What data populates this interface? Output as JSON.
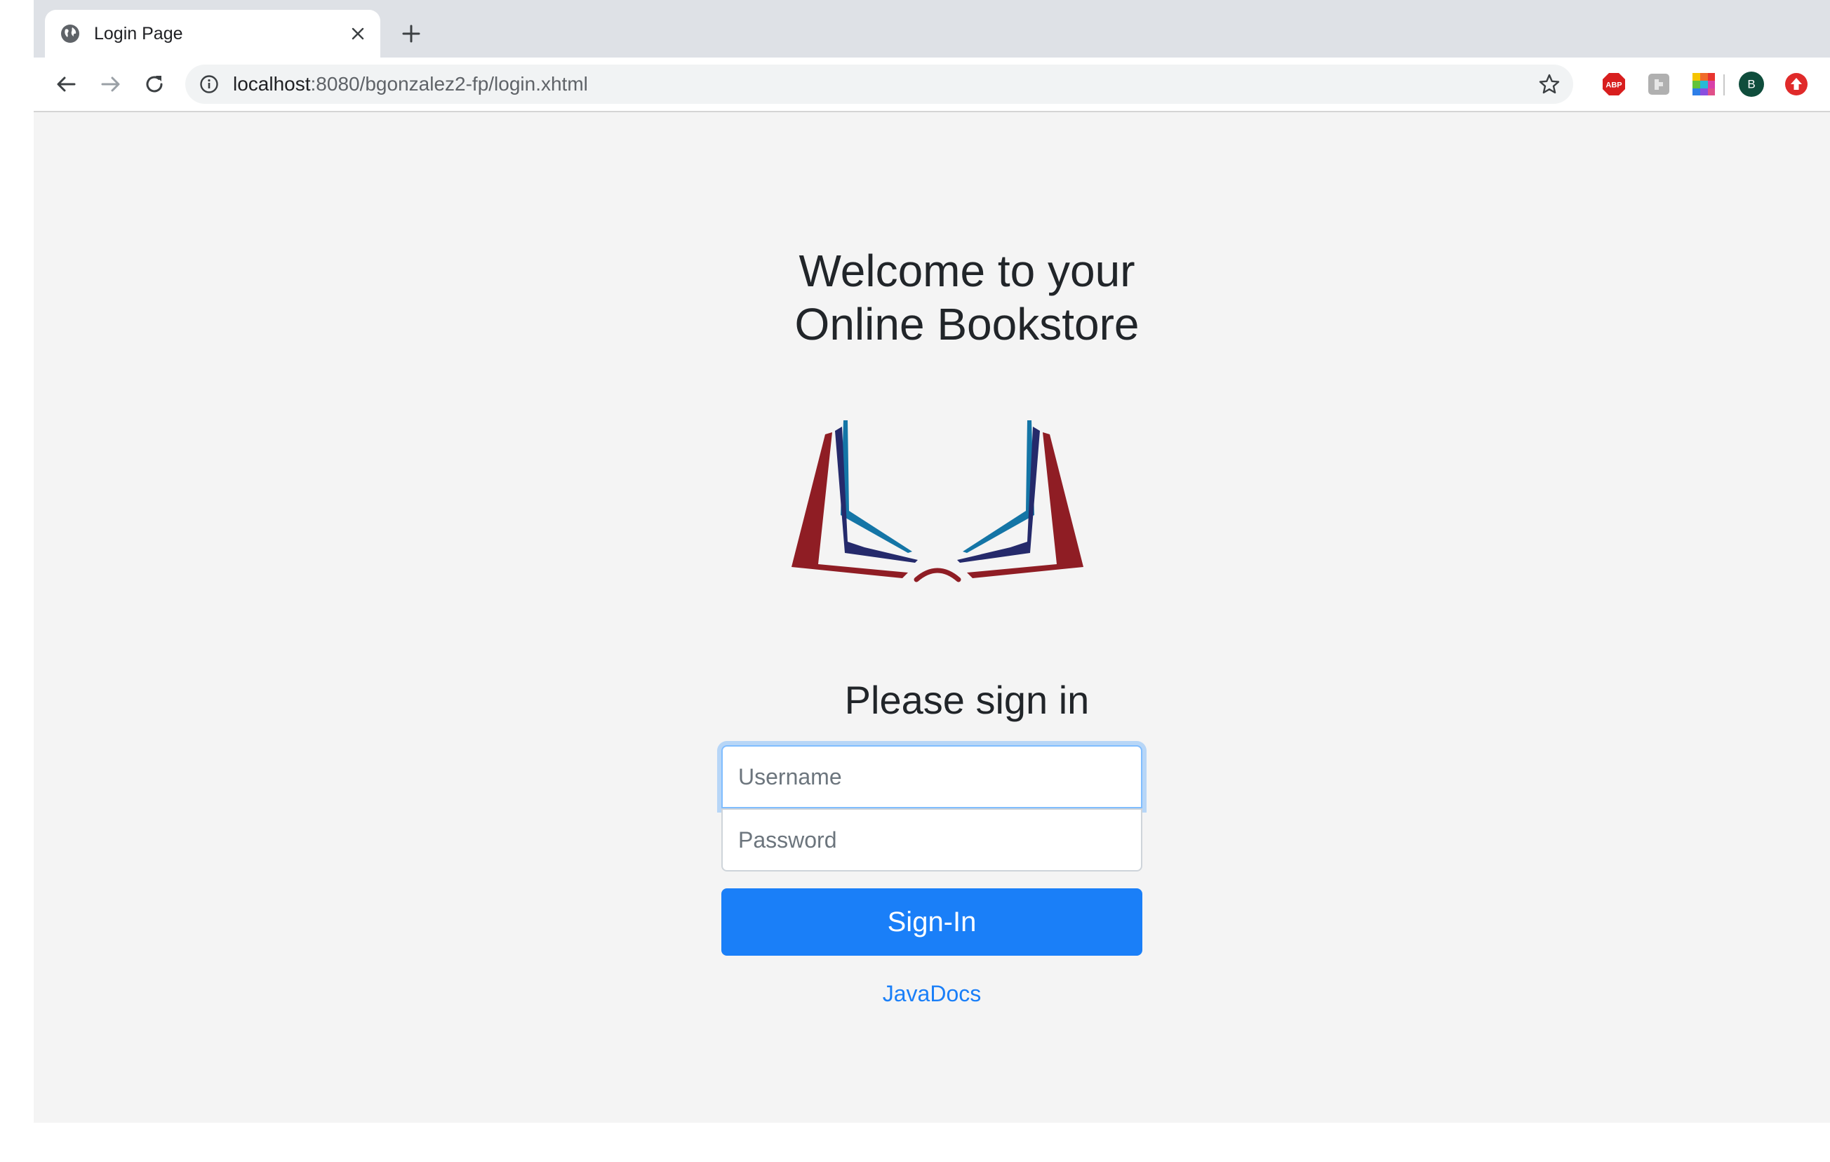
{
  "browser": {
    "tab": {
      "title": "Login Page",
      "icon": "globe-icon"
    },
    "address_bar": {
      "host": "localhost",
      "path": ":8080/bgonzalez2-fp/login.xhtml"
    },
    "extensions": [
      {
        "name": "adblock-plus-icon",
        "label": "ABP",
        "color": "#d81e1e"
      },
      {
        "name": "puzzle-extension-icon",
        "color": "#b0b0b0"
      },
      {
        "name": "color-grid-extension-icon"
      },
      {
        "name": "profile-avatar",
        "label": "B",
        "color": "#0f4d3c"
      },
      {
        "name": "update-icon",
        "color": "#e02a2a"
      }
    ]
  },
  "page": {
    "welcome_line1": "Welcome to your",
    "welcome_line2": "Online Bookstore",
    "signin_heading": "Please sign in",
    "username_placeholder": "Username",
    "password_placeholder": "Password",
    "signin_button": "Sign-In",
    "javadocs_link": "JavaDocs"
  },
  "colors": {
    "accent": "#1a7ff8",
    "logo_red": "#8f1d24",
    "logo_navy": "#252a6b",
    "logo_teal": "#1475a6"
  }
}
